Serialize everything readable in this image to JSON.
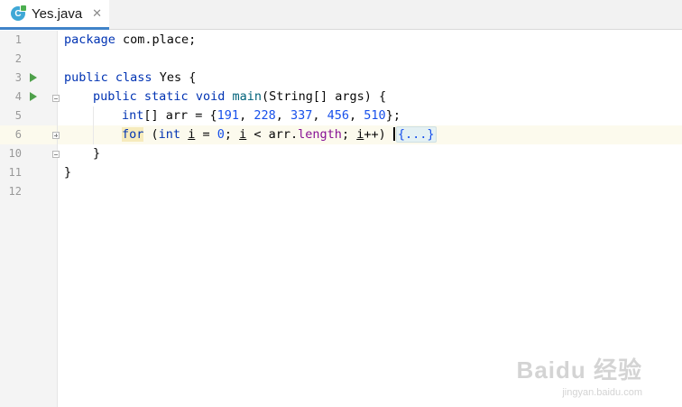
{
  "tab": {
    "icon_letter": "C",
    "filename": "Yes.java",
    "close_glyph": "✕"
  },
  "editor": {
    "line_numbers": [
      "1",
      "2",
      "3",
      "4",
      "5",
      "6",
      "10",
      "11",
      "12"
    ],
    "code": {
      "l1_kw": "package",
      "l1_rest": " com.place;",
      "l3_kw1": "public",
      "l3_kw2": "class",
      "l3_rest": " Yes {",
      "l4_kw1": "public",
      "l4_kw2": "static",
      "l4_kw3": "void",
      "l4_fn": "main",
      "l4_rest": "(String[] args) {",
      "l5_type": "int",
      "l5_a": "[] arr = {",
      "l5_n1": "191",
      "l5_n2": "228",
      "l5_n3": "337",
      "l5_n4": "456",
      "l5_n5": "510",
      "l5_end": "};",
      "comma": ", ",
      "l6_for": "for",
      "l6_open": " (",
      "l6_int": "int",
      "l6_sp": " ",
      "l6_i1": "i",
      "l6_eq": " = ",
      "l6_zero": "0",
      "l6_semi1": "; ",
      "l6_i2": "i",
      "l6_lt": " < arr.",
      "l6_len": "length",
      "l6_semi2": "; ",
      "l6_i3": "i",
      "l6_inc": "++) ",
      "l6_fold": "{...}",
      "l10": "}",
      "l11": "}"
    }
  },
  "watermark": {
    "main": "Baidu 经验",
    "sub": "jingyan.baidu.com"
  }
}
